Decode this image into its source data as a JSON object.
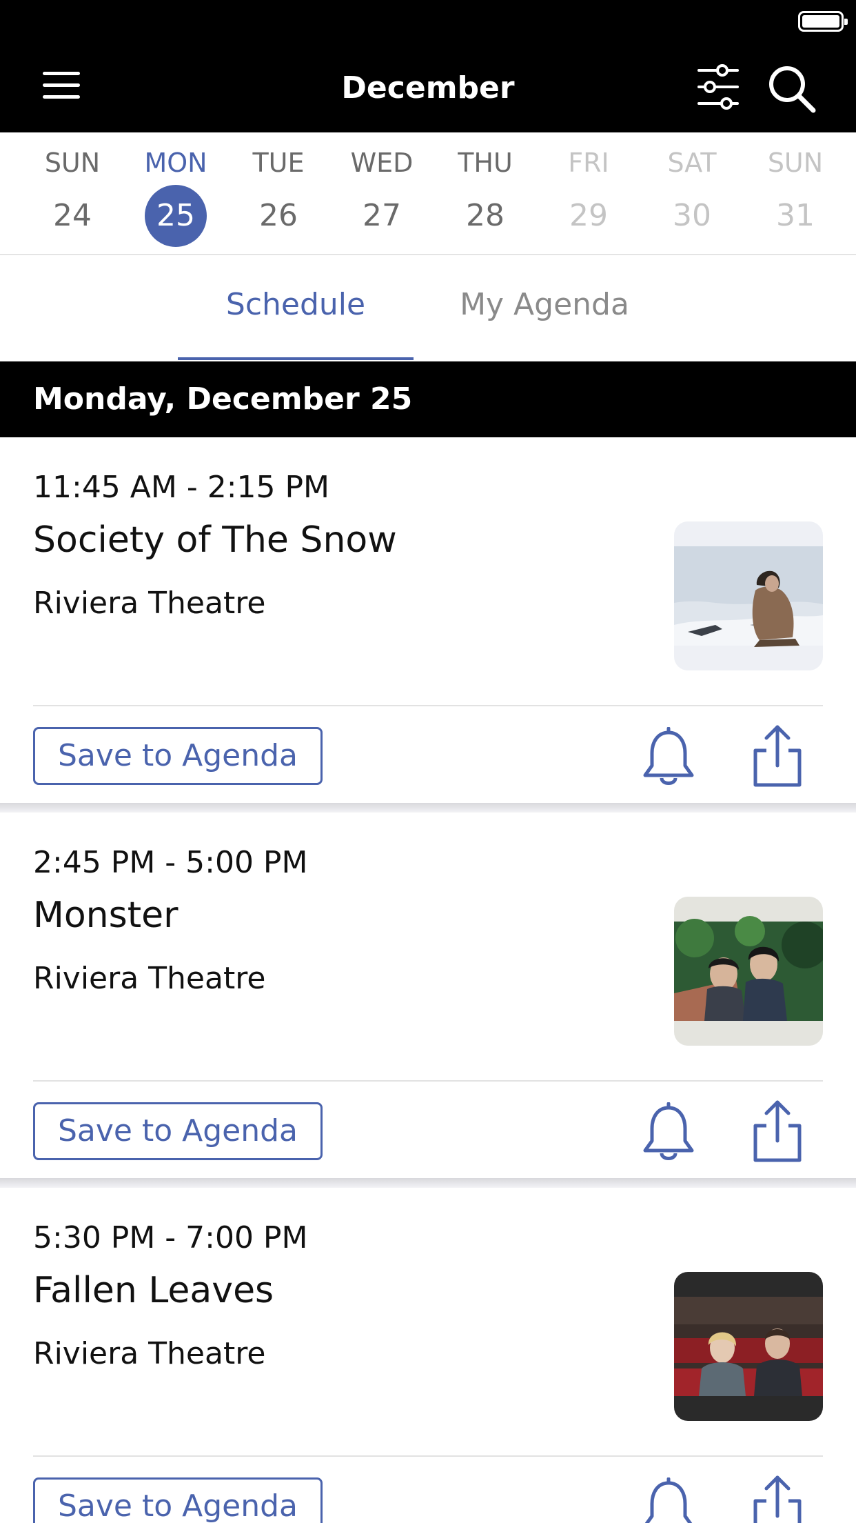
{
  "header": {
    "title": "December",
    "menu_icon": "hamburger-menu-icon",
    "filter_icon": "sliders-filter-icon",
    "search_icon": "search-icon",
    "background": "#000000"
  },
  "status_bar": {
    "battery_icon": "battery-icon"
  },
  "week": [
    {
      "dow": "SUN",
      "date": "24",
      "state": "normal"
    },
    {
      "dow": "MON",
      "date": "25",
      "state": "selected"
    },
    {
      "dow": "TUE",
      "date": "26",
      "state": "normal"
    },
    {
      "dow": "WED",
      "date": "27",
      "state": "normal"
    },
    {
      "dow": "THU",
      "date": "28",
      "state": "normal"
    },
    {
      "dow": "FRI",
      "date": "29",
      "state": "disabled"
    },
    {
      "dow": "SAT",
      "date": "30",
      "state": "disabled"
    },
    {
      "dow": "SUN",
      "date": "31",
      "state": "disabled"
    }
  ],
  "tabs": [
    {
      "label": "Schedule",
      "active": true
    },
    {
      "label": "My Agenda",
      "active": false
    }
  ],
  "section_header": "Monday, December 25",
  "events": [
    {
      "time": "11:45 AM - 2:15 PM",
      "title": "Society of The Snow",
      "venue": "Riviera Theatre",
      "save_label": "Save to Agenda",
      "thumbnail": "snow-film-still"
    },
    {
      "time": "2:45 PM - 5:00 PM",
      "title": "Monster",
      "venue": "Riviera Theatre",
      "save_label": "Save to Agenda",
      "thumbnail": "monster-film-still"
    },
    {
      "time": "5:30 PM - 7:00 PM",
      "title": "Fallen Leaves",
      "venue": "Riviera Theatre",
      "save_label": "Save to Agenda",
      "thumbnail": "fallen-leaves-film-still"
    }
  ],
  "colors": {
    "accent": "#4a63ad",
    "muted_text": "#6a6a6a",
    "disabled_text": "#c4c4c4",
    "divider": "#e2e2e2"
  }
}
